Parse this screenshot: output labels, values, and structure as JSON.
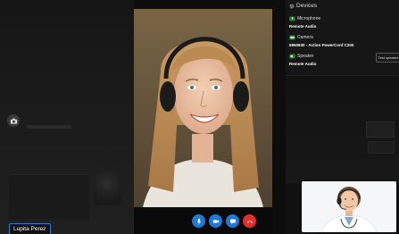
{
  "participant": {
    "name": "Lupita Perez"
  },
  "devices": {
    "title": "Devices",
    "microphone": {
      "label": "Microphone",
      "value": "Remote Audio"
    },
    "camera": {
      "label": "Camera",
      "value": "6950930 - Action PowerConf C200"
    },
    "speaker": {
      "label": "Speaker",
      "value": "Remote Audio",
      "test_button": "Test speaker"
    }
  },
  "controls": {
    "mic": "microphone-icon",
    "video": "video-camera-icon",
    "chat": "chat-icon",
    "end": "end-call-icon"
  },
  "colors": {
    "control_blue": "#1e7ad6",
    "end_call_red": "#e0302a",
    "name_tag_border": "#3a7bd5"
  }
}
